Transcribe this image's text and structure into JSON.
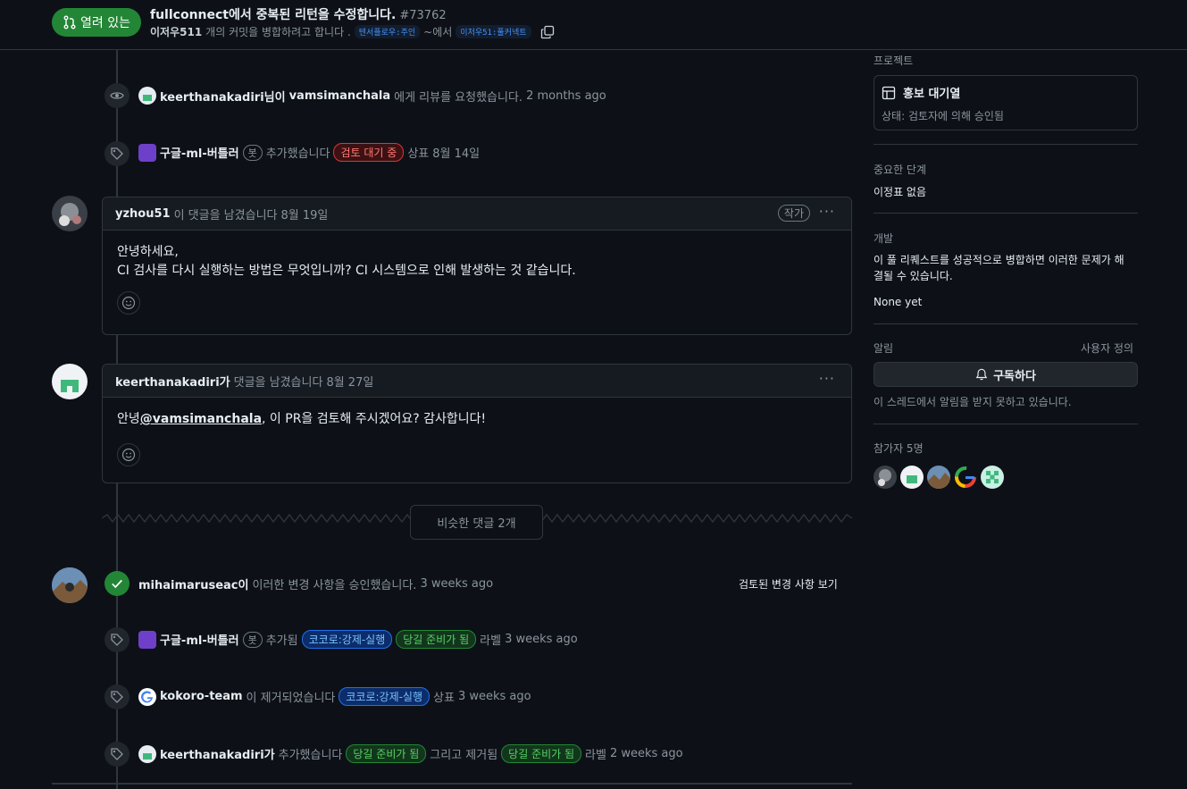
{
  "header": {
    "state_label": "열려 있는",
    "title": "fullconnect에서 중복된 리턴을 수정합니다.",
    "number": "#73762",
    "author": "이저우511",
    "subtitle_mid": "개의 커밋을 병합하려고 합니다 .",
    "base_branch": "텐서플로우:주인",
    "from_text": "~에서",
    "head_branch": "이저우51:풀커넥트"
  },
  "timeline": {
    "review_request": {
      "user": "keerthanakadiri님이",
      "target": "vamsimanchala",
      "text": "에게 리뷰를 요청했습니다.",
      "time": "2 months ago"
    },
    "label_event1": {
      "user": "구글-ml-버틀러",
      "bot": "봇",
      "action": "추가했습니다",
      "label": "검토 대기 중",
      "suffix": "상표",
      "time": "8월 14일"
    },
    "comment1": {
      "user": "yzhou51",
      "action": "이 댓글을 남겼습니다",
      "time": "8월 19일",
      "badge": "작가",
      "line1": "안녕하세요,",
      "line2": "CI 검사를 다시 실행하는 방법은 무엇입니까? CI 시스템으로 인해 발생하는 것 같습니다."
    },
    "comment2": {
      "user": "keerthanakadiri가",
      "action": "댓글을 남겼습니다",
      "time": "8월 27일",
      "greeting": "안녕",
      "mention": "@vamsimanchala",
      "rest": ", 이 PR을 검토해 주시겠어요? 감사합니다!"
    },
    "hidden_comments": "비슷한 댓글 2개",
    "approval": {
      "user": "mihaimaruseac이",
      "text": "이러한 변경 사항을 승인했습니다.",
      "time": "3 weeks ago",
      "link": "검토된 변경 사항 보기"
    },
    "label_event2": {
      "user": "구글-ml-버틀러",
      "bot": "봇",
      "action": "추가됨",
      "label1": "코코로:강제-실행",
      "label2": "당길 준비가 됨",
      "suffix": "라벨",
      "time": "3 weeks ago"
    },
    "label_event3": {
      "user": "kokoro-team",
      "action": "이 제거되었습니다",
      "label": "코코로:강제-실행",
      "suffix": "상표",
      "time": "3 weeks ago"
    },
    "label_event4": {
      "user": "keerthanakadiri가",
      "action": "추가했습니다",
      "label1": "당길 준비가 됨",
      "mid": "그리고 제거됨",
      "label2": "당길 준비가 됨",
      "suffix": "라벨",
      "time": "2 weeks ago"
    }
  },
  "sidebar": {
    "projects_heading": "프로젝트",
    "project_name": "홍보 대기열",
    "project_status": "상태: 검토자에 의해 승인됨",
    "milestone_heading": "중요한 단계",
    "milestone_value": "이정표 없음",
    "development_heading": "개발",
    "development_text": "이 풀 리퀘스트를 성공적으로 병합하면 이러한 문제가 해결될 수 있습니다.",
    "development_none": "None yet",
    "notifications_heading": "알림",
    "customize": "사용자 정의",
    "subscribe": "구독하다",
    "notif_text": "이 스레드에서 알림을 받지 못하고 있습니다.",
    "participants_heading": "참가자 5명"
  },
  "colors": {
    "bg": "#0d1117",
    "open_green": "#238636",
    "link_blue": "#4493f8"
  }
}
